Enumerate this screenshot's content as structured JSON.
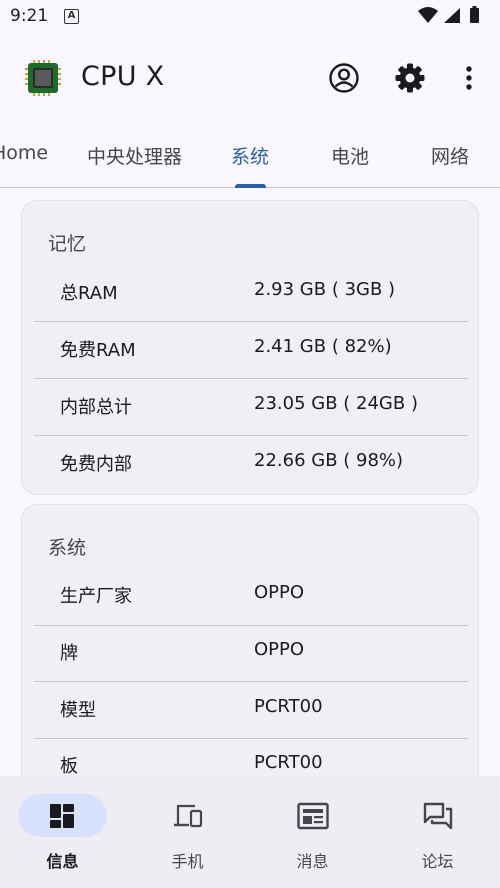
{
  "status_bar": {
    "time": "9:21",
    "notification_icon": "a-icon",
    "right_icons": [
      "wifi-icon",
      "signal-icon",
      "battery-icon"
    ]
  },
  "app_bar": {
    "title": "CPU X",
    "logo_text": "CPU",
    "actions": [
      "account-icon",
      "settings-icon",
      "more-vert-icon"
    ]
  },
  "tabs": [
    {
      "label": "Home",
      "active": false
    },
    {
      "label": "中央处理器",
      "active": false
    },
    {
      "label": "系统",
      "active": true
    },
    {
      "label": "电池",
      "active": false
    },
    {
      "label": "网络",
      "active": false
    }
  ],
  "memory_card": {
    "title": "记忆",
    "rows": [
      {
        "label": "总RAM",
        "value": "2.93 GB ( 3GB )"
      },
      {
        "label": "免费RAM",
        "value": "2.41 GB ( 82%)"
      },
      {
        "label": "内部总计",
        "value": "23.05 GB ( 24GB )"
      },
      {
        "label": "免费内部",
        "value": "22.66 GB ( 98%)"
      }
    ]
  },
  "system_card": {
    "title": "系统",
    "rows": [
      {
        "label": "生产厂家",
        "value": "OPPO"
      },
      {
        "label": "牌",
        "value": "OPPO"
      },
      {
        "label": "模型",
        "value": "PCRT00"
      },
      {
        "label": "板",
        "value": "PCRT00"
      }
    ]
  },
  "bottom_nav": [
    {
      "label": "信息",
      "icon": "dashboard-icon",
      "active": true
    },
    {
      "label": "手机",
      "icon": "devices-icon",
      "active": false
    },
    {
      "label": "消息",
      "icon": "newspaper-icon",
      "active": false
    },
    {
      "label": "论坛",
      "icon": "forum-icon",
      "active": false
    }
  ],
  "colors": {
    "accent": "#2a5ea6",
    "nav_pill": "#d8e2ff",
    "card_bg": "#f2eff4",
    "background": "#fbf8fd"
  }
}
